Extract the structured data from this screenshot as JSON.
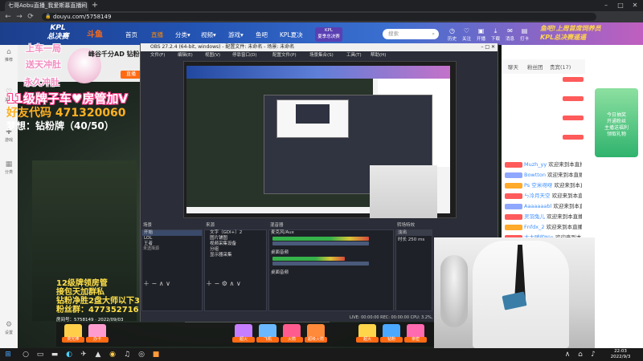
{
  "browser": {
    "tab_title": "七哥Aobu直播_我爱斯慕直播间",
    "new_tab": "+",
    "url": "douyu.com/5758149",
    "window_controls": [
      "–",
      "□",
      "✕"
    ],
    "nav": [
      "←",
      "→",
      "⟳"
    ]
  },
  "douyu": {
    "kpl_left": "KPL\n总决赛",
    "logo": "斗鱼",
    "nav": [
      "首页",
      "直播",
      "分类",
      "视频",
      "游戏",
      "鱼吧",
      "KPL夏决"
    ],
    "active_nav": "直播",
    "kpl_badge": "KPL\n夏季总决赛",
    "search_placeholder": "搜索",
    "top_icons": [
      "历史",
      "关注",
      "开播",
      "下载",
      "消息",
      "打卡"
    ],
    "kpl_right": "鱼吧!上周首席饲养员\nKPL总决赛遥遥"
  },
  "sidebar": {
    "items": [
      "推荐",
      "关注",
      "游戏",
      "分类",
      "设置"
    ]
  },
  "stream": {
    "title": "峰谷千分AD 钻粉",
    "room_tag": "直播",
    "overlay_top1": "上车一局",
    "overlay_top2": "送天冲肚",
    "overlay_top3": "永久冲肚",
    "overlay_fang": "11级牌子车♥房管加V",
    "overlay_code": "好友代码 471320060",
    "overlay_light": "梦想：钻粉牌（40/50）",
    "overlay_bottom": "12级牌领房管\n接包天加群私\n钻粉净胜2盘大师以下3盘\n粉丝群：477352716",
    "room_footer": "房间号：5758149 · 2022/09/03",
    "gifts": [
      "荧光棒",
      "办卡",
      "超火",
      "飞机",
      "火箭",
      "超级火箭",
      "超大",
      "钻粉",
      "亲密"
    ]
  },
  "chat": {
    "tabs": [
      "聊天",
      "粉丝团",
      "贵宾(17)"
    ],
    "rows": [
      {
        "name": "Muzh_yy",
        "text": "欢迎来到本直播间"
      },
      {
        "name": "Bowtton",
        "text": "欢迎来到本直播间"
      },
      {
        "name": "Ps 空米呀呀",
        "text": "欢迎来到本直播间"
      },
      {
        "name": "ㄣ冷月天空",
        "text": "欢迎来到本直播间"
      },
      {
        "name": "Aaaaaaabl",
        "text": "欢迎来到本直播间"
      },
      {
        "name": "灵羽兔儿",
        "text": "欢迎来到本直播间"
      },
      {
        "name": "Fnfdx_2",
        "text": "欢迎来到本直播间"
      },
      {
        "name": "大大嗳的Nin",
        "text": "欢迎来到本直播间"
      }
    ],
    "promo": "今日抽奖\n开通粉丝\n主播送福利\n领取礼物"
  },
  "obs": {
    "title": "OBS 27.2.4 (64-bit, windows) - 配置文件: 未命名 - 场景: 未命名",
    "menu": [
      "文件(F)",
      "编辑(E)",
      "视图(V)",
      "停靠窗口(D)",
      "配置文件(P)",
      "场景集合(S)",
      "工具(T)",
      "帮助(H)"
    ],
    "docks": [
      {
        "title": "场景",
        "rows": [
          "开始",
          "LOL",
          "王者"
        ]
      },
      {
        "title": "来源",
        "rows": [
          "文字（GDI+）2",
          "图片铺图",
          "视频采集设备",
          "分组",
          "显示器采集"
        ]
      },
      {
        "title": "混音器",
        "rows": [
          "麦克风/Aux",
          "桌面音频",
          "桌面音频"
        ]
      },
      {
        "title": "转场特效",
        "rows": [
          "淡出",
          "时长 250 ms"
        ]
      }
    ],
    "status": "LIVE: 00:00:00  REC: 00:00:00  CPU: 3.2%, 30.00 fps",
    "filter_label": "未选择源"
  },
  "taskbar": {
    "time": "22:03",
    "date": "2022/9/3"
  },
  "colors": {
    "accent": "#ff6a13",
    "douyu_blue": "#2353b3",
    "overlay_pink": "#f28ac0"
  }
}
